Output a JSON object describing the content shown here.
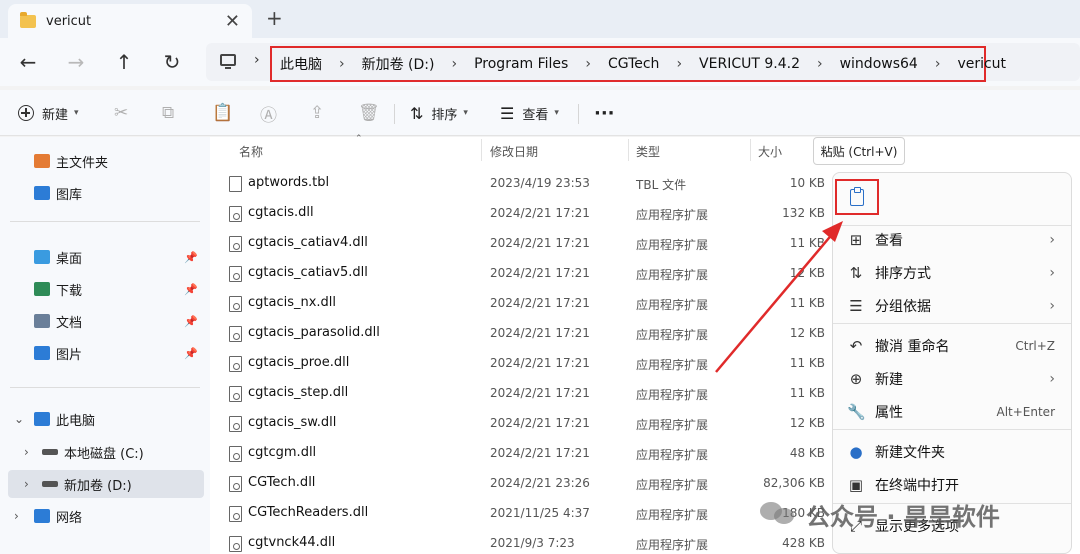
{
  "tab": {
    "title": "vericut",
    "close": "✕",
    "new_tab": "+"
  },
  "nav": {
    "back": "←",
    "forward": "→",
    "up": "↑",
    "refresh": "↻"
  },
  "address": {
    "crumbs": [
      "此电脑",
      "新加卷 (D:)",
      "Program Files",
      "CGTech",
      "VERICUT 9.4.2",
      "windows64",
      "vericut"
    ],
    "separator": "›"
  },
  "toolbar": {
    "new_label": "新建",
    "sort_label": "排序",
    "view_label": "查看",
    "more": "···"
  },
  "sidebar": {
    "items": [
      {
        "label": "主文件夹",
        "color": "#e47b34"
      },
      {
        "label": "图库",
        "color": "#2c7cd6"
      },
      {
        "label": "桌面",
        "color": "#3a9be0"
      },
      {
        "label": "下载",
        "color": "#2e8b57"
      },
      {
        "label": "文档",
        "color": "#6a7f99"
      },
      {
        "label": "图片",
        "color": "#2c7cd6"
      },
      {
        "label": "此电脑",
        "color": "#2c7cd6"
      },
      {
        "label": "本地磁盘 (C:)",
        "color": "#555555"
      },
      {
        "label": "新加卷 (D:)",
        "color": "#555555"
      },
      {
        "label": "网络",
        "color": "#2c7cd6"
      }
    ]
  },
  "columns": {
    "name": "名称",
    "date": "修改日期",
    "type": "类型",
    "size": "大小"
  },
  "files": [
    {
      "name": "aptwords.tbl",
      "date": "2023/4/19 23:53",
      "type": "TBL 文件",
      "size": "10 KB",
      "kind": "file"
    },
    {
      "name": "cgtacis.dll",
      "date": "2024/2/21 17:21",
      "type": "应用程序扩展",
      "size": "132 KB",
      "kind": "dll"
    },
    {
      "name": "cgtacis_catiav4.dll",
      "date": "2024/2/21 17:21",
      "type": "应用程序扩展",
      "size": "11 KB",
      "kind": "dll"
    },
    {
      "name": "cgtacis_catiav5.dll",
      "date": "2024/2/21 17:21",
      "type": "应用程序扩展",
      "size": "12 KB",
      "kind": "dll"
    },
    {
      "name": "cgtacis_nx.dll",
      "date": "2024/2/21 17:21",
      "type": "应用程序扩展",
      "size": "11 KB",
      "kind": "dll"
    },
    {
      "name": "cgtacis_parasolid.dll",
      "date": "2024/2/21 17:21",
      "type": "应用程序扩展",
      "size": "12 KB",
      "kind": "dll"
    },
    {
      "name": "cgtacis_proe.dll",
      "date": "2024/2/21 17:21",
      "type": "应用程序扩展",
      "size": "11 KB",
      "kind": "dll"
    },
    {
      "name": "cgtacis_step.dll",
      "date": "2024/2/21 17:21",
      "type": "应用程序扩展",
      "size": "11 KB",
      "kind": "dll"
    },
    {
      "name": "cgtacis_sw.dll",
      "date": "2024/2/21 17:21",
      "type": "应用程序扩展",
      "size": "12 KB",
      "kind": "dll"
    },
    {
      "name": "cgtcgm.dll",
      "date": "2024/2/21 17:21",
      "type": "应用程序扩展",
      "size": "48 KB",
      "kind": "dll"
    },
    {
      "name": "CGTech.dll",
      "date": "2024/2/21 23:26",
      "type": "应用程序扩展",
      "size": "82,306 KB",
      "kind": "dll"
    },
    {
      "name": "CGTechReaders.dll",
      "date": "2021/11/25 4:37",
      "type": "应用程序扩展",
      "size": "180 KB",
      "kind": "dll"
    },
    {
      "name": "cgtvnck44.dll",
      "date": "2021/9/3 7:23",
      "type": "应用程序扩展",
      "size": "428 KB",
      "kind": "dll"
    }
  ],
  "context_menu": {
    "tooltip": "粘贴 (Ctrl+V)",
    "items": [
      {
        "icon": "⊞",
        "label": "查看",
        "arrow": "›"
      },
      {
        "icon": "⇅",
        "label": "排序方式",
        "arrow": "›"
      },
      {
        "icon": "☰",
        "label": "分组依据",
        "arrow": "›"
      },
      {
        "icon": "↶",
        "label": "撤消 重命名",
        "shortcut": "Ctrl+Z"
      },
      {
        "icon": "⊕",
        "label": "新建",
        "arrow": "›"
      },
      {
        "icon": "🔧",
        "label": "属性",
        "shortcut": "Alt+Enter"
      },
      {
        "icon": "●",
        "label": "新建文件夹"
      },
      {
        "icon": "▣",
        "label": "在终端中打开"
      },
      {
        "icon": "⤢",
        "label": "显示更多选项"
      }
    ]
  },
  "watermark": "公众号 · 旱旱软件",
  "colors": {
    "highlight": "#e02a2a",
    "accent": "#2a6fc7"
  }
}
